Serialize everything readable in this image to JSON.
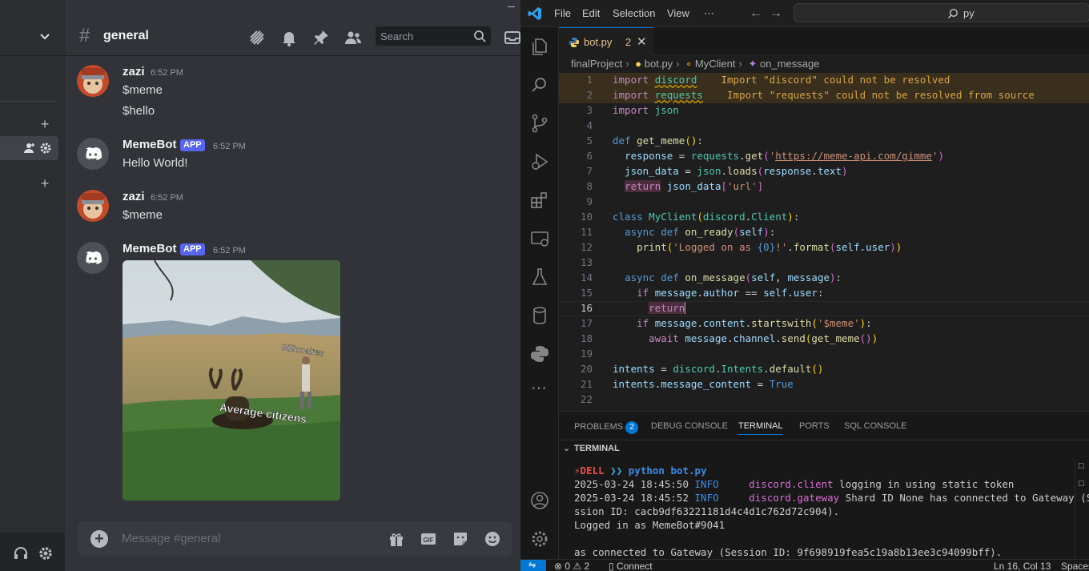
{
  "discord": {
    "channel": "general",
    "search_placeholder": "Search",
    "composer_placeholder": "Message #general",
    "messages": [
      {
        "author": "zazi",
        "time": "6:52 PM",
        "lines": [
          "$meme",
          "$hello"
        ]
      },
      {
        "author": "MemeBot",
        "badge": "APP",
        "time": "6:52 PM",
        "lines": [
          "Hello World!"
        ]
      },
      {
        "author": "zazi",
        "time": "6:52 PM",
        "lines": [
          "$meme"
        ]
      },
      {
        "author": "MemeBot",
        "badge": "APP",
        "time": "6:52 PM",
        "lines": []
      }
    ],
    "meme": {
      "label_top": "Billionaires",
      "label_bottom": "Average citizens"
    },
    "icons": [
      "threads-icon",
      "bell-icon",
      "pin-icon",
      "members-icon",
      "search-icon",
      "inbox-icon",
      "gift-icon",
      "gif-icon",
      "sticker-icon",
      "emoji-icon",
      "headset-icon",
      "gear-icon"
    ]
  },
  "vscode": {
    "menu": [
      "File",
      "Edit",
      "Selection",
      "View",
      "⋯"
    ],
    "command_center": "py",
    "tab": {
      "name": "bot.py",
      "problems": "2"
    },
    "breadcrumbs": [
      "finalProject",
      "bot.py",
      "MyClient",
      "on_message"
    ],
    "line_numbers": [
      "1",
      "2",
      "3",
      "4",
      "5",
      "6",
      "7",
      "8",
      "9",
      "10",
      "11",
      "12",
      "13",
      "14",
      "15",
      "16",
      "17",
      "18",
      "19",
      "20",
      "21",
      "22"
    ],
    "diagnostics": {
      "line1": "Import \"discord\" could not be resolved",
      "line2": "Import \"requests\" could not be resolved from source"
    },
    "panel_tabs": [
      "PROBLEMS",
      "DEBUG CONSOLE",
      "TERMINAL",
      "PORTS",
      "SQL CONSOLE"
    ],
    "problems_count": "2",
    "terminal_title": "TERMINAL",
    "terminal": {
      "prompt_host": "DELL",
      "prompt_cmd": "python bot.py",
      "log1_time": "2025-03-24 18:45:50",
      "log1_level": "INFO",
      "log1_src": "discord.client",
      "log1_msg": "logging in using static token",
      "log2_time": "2025-03-24 18:45:52",
      "log2_level": "INFO",
      "log2_src": "discord.gateway",
      "log2_msg": "Shard ID None has connected to Gateway (Se",
      "log2_cont": "ssion ID: cacb9df63221181d4c4d1c762d72c904).",
      "logged_in": "Logged in as MemeBot#9041",
      "tail": "as connected to Gateway (Session ID: 9f698919fea5c19a8b13ee3c94099bff)."
    },
    "status": {
      "errors": "0",
      "warnings": "2",
      "connect": "Connect",
      "position": "Ln 16, Col 13",
      "spaces": "Spaces"
    }
  }
}
